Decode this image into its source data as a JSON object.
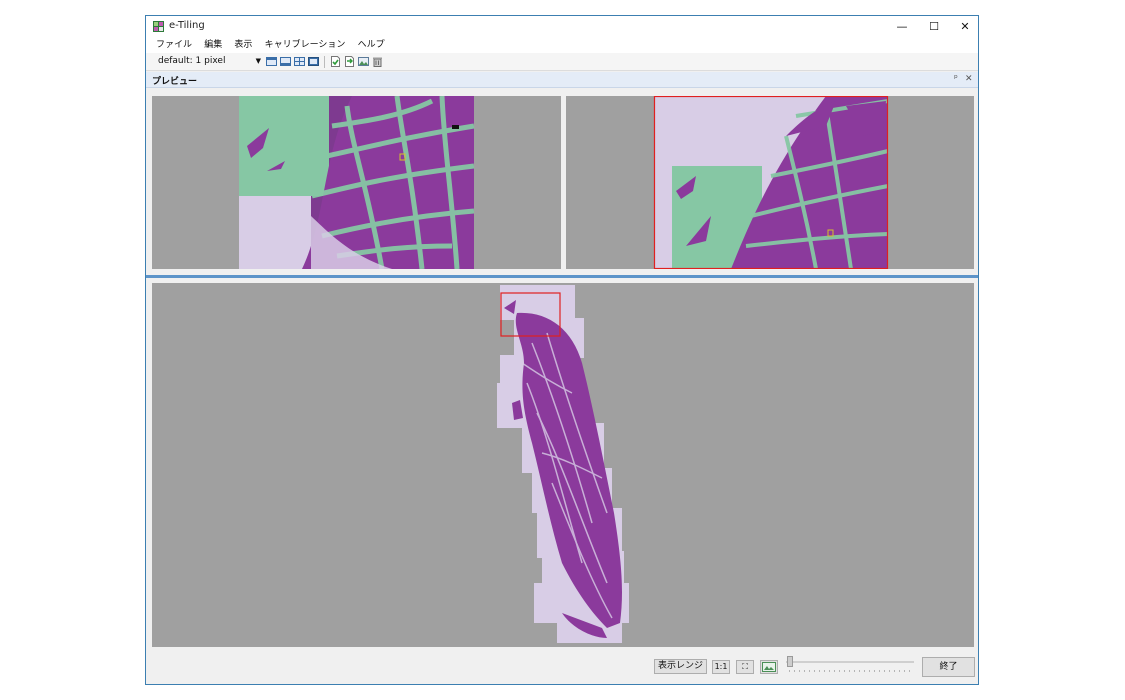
{
  "window": {
    "title": "e-Tiling",
    "controls": {
      "minimize": "—",
      "maximize": "☐",
      "close": "✕"
    }
  },
  "menu": [
    "ファイル",
    "編集",
    "表示",
    "キャリブレーション",
    "ヘルプ"
  ],
  "toolbar": {
    "combo_value": "default: 1 pixel",
    "icons": [
      "tile-icon",
      "tile-icon",
      "tile-icon",
      "tile-icon",
      "export-icon",
      "export-icon",
      "image-icon",
      "trash-icon"
    ]
  },
  "panel": {
    "title": "プレビュー",
    "pin_glyph": "ᵖ",
    "close_glyph": "✕"
  },
  "bottom": {
    "range_button": "表示レンジ",
    "zoom_1to1": "1:1",
    "fit_glyph": "⛶",
    "finish_button": "終了"
  },
  "colors": {
    "accent": "#3c7fb1",
    "splitter": "#5d94c9",
    "tissue_purple": "#8b3a9c",
    "background_tissue": "#d8cde6",
    "green_overlay": "#86c7a4",
    "selection_red": "#e02020",
    "viewer_gray": "#a0a0a0"
  }
}
